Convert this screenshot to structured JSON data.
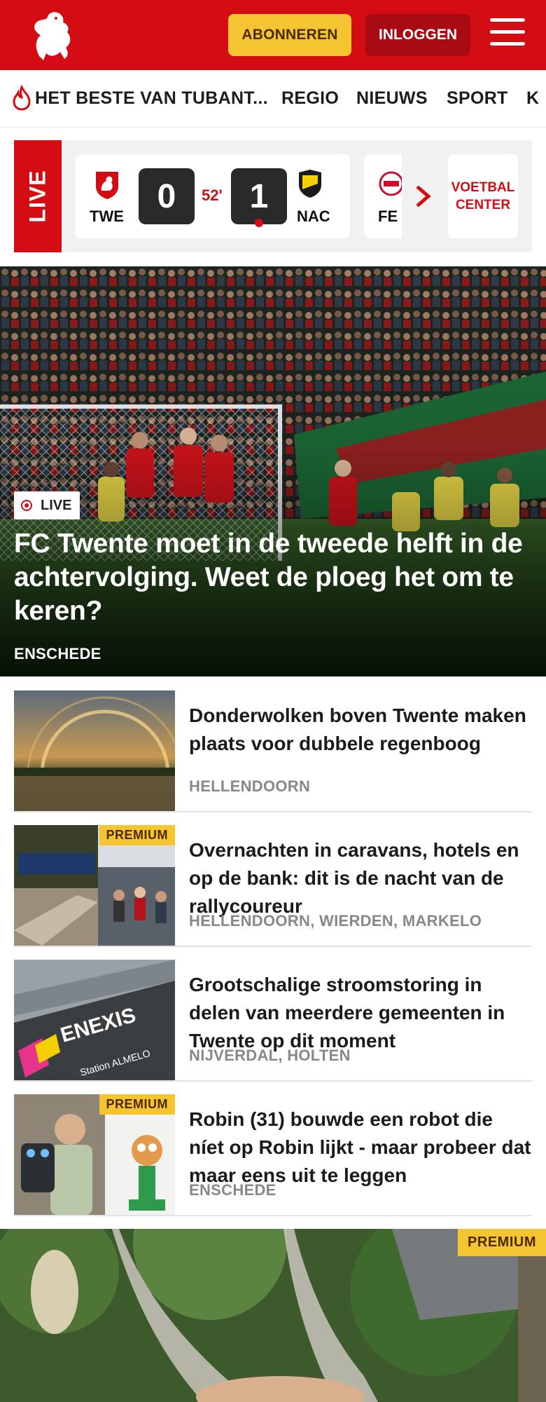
{
  "header": {
    "subscribe_label": "ABONNEREN",
    "login_label": "INLOGGEN",
    "brand_color": "#d40d14",
    "subscribe_color": "#f4c431"
  },
  "nav": {
    "items": [
      "HET BESTE VAN TUBANT...",
      "REGIO",
      "NIEUWS",
      "SPORT",
      "K"
    ]
  },
  "live": {
    "label": "LIVE",
    "match": {
      "home": "TWE",
      "away": "NAC",
      "home_score": "0",
      "away_score": "1",
      "minute": "52'"
    },
    "next_team": "FE",
    "voetbal_center": "VOETBAL CENTER"
  },
  "hero": {
    "tag": "LIVE",
    "title": "FC Twente moet in de tweede helft in de achtervolging. Weet de ploeg het om te keren?",
    "location": "ENSCHEDE"
  },
  "articles": [
    {
      "title": "Donderwolken boven Twente maken plaats voor dubbele regenboog",
      "location": "HELLENDOORN",
      "premium": ""
    },
    {
      "title": "Overnachten in caravans, hotels en op de bank: dit is de nacht van de rallycoureur",
      "location": "HELLENDOORN, WIERDEN, MARKELO",
      "premium": "PREMIUM"
    },
    {
      "title": "Grootschalige stroomstoring in delen van meerdere gemeenten in Twente op dit moment",
      "location": "NIJVERDAL, HOLTEN",
      "premium": "",
      "image_text": "ENEXIS",
      "image_subtext": "Station ALMELO"
    },
    {
      "title": "Robin (31) bouwde een robot die níet op Robin lijkt - maar probeer dat maar eens uit te leggen",
      "location": "ENSCHEDE",
      "premium": "PREMIUM"
    }
  ],
  "bottom": {
    "premium": "PREMIUM"
  }
}
